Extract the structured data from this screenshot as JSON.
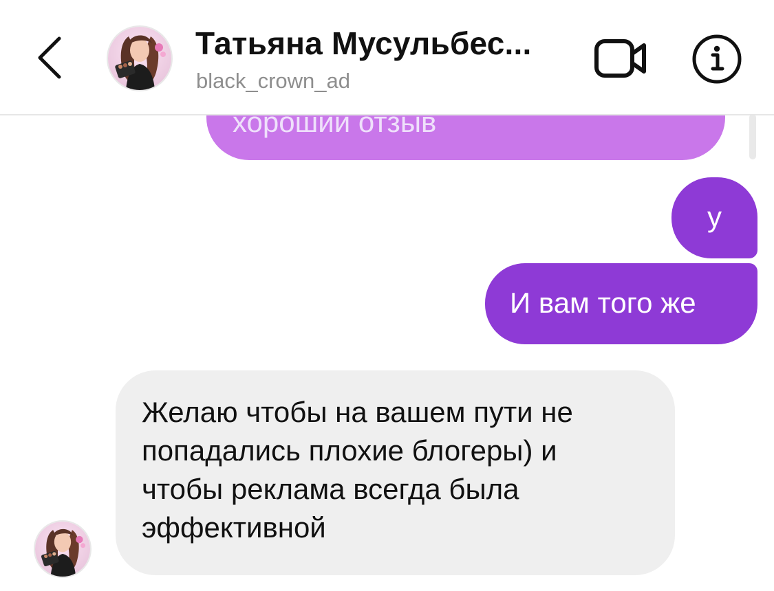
{
  "header": {
    "contact_name": "Татьяна Мусульбес...",
    "username": "black_crown_ad",
    "back_icon": "chevron-left-icon",
    "video_icon": "video-camera-icon",
    "info_icon": "info-icon"
  },
  "messages": [
    {
      "direction": "outgoing",
      "text": "хороший отзыв",
      "partially_visible": true
    },
    {
      "direction": "outgoing",
      "text": "у"
    },
    {
      "direction": "outgoing",
      "text": "И вам того же"
    },
    {
      "direction": "incoming",
      "text": "Желаю чтобы на вашем пути не\nпопадались плохие блогеры) и\nчтобы реклама всегда была\nэффективной"
    }
  ],
  "colors": {
    "outgoing_bubble": "#8e3ad6",
    "outgoing_bubble_faded": "#c977ea",
    "incoming_bubble": "#efefef",
    "username_gray": "#8e8e8e"
  }
}
